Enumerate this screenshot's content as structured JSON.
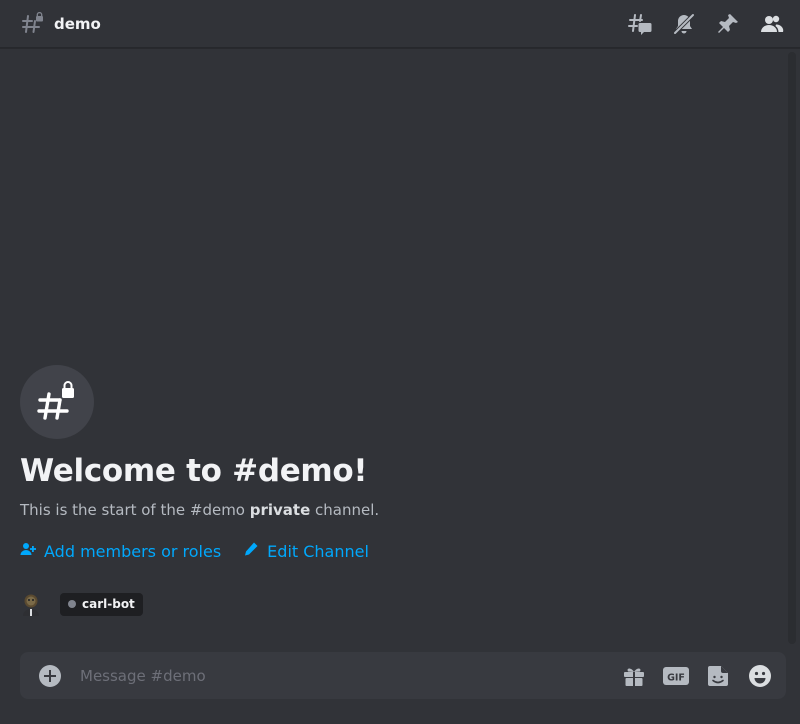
{
  "header": {
    "channel_name": "demo",
    "icons": [
      "locked-hash-icon",
      "threads-icon",
      "notifications-muted-icon",
      "pin-icon",
      "member-list-icon"
    ]
  },
  "welcome": {
    "title": "Welcome to #demo!",
    "subtitle_prefix": "This is the start of the #demo ",
    "subtitle_bold": "private",
    "subtitle_suffix": " channel.",
    "add_members_label": "Add members or roles",
    "edit_channel_label": "Edit Channel"
  },
  "members": [
    {
      "name": "carl-bot",
      "status_color": "#80848e"
    }
  ],
  "composer": {
    "placeholder": "Message #demo",
    "value": "",
    "gif_label": "GIF",
    "icons": [
      "add-attachment-icon",
      "gift-icon",
      "gif-icon",
      "sticker-icon",
      "emoji-icon"
    ]
  },
  "colors": {
    "background": "#313338",
    "composer": "#383a40",
    "link": "#00a8fc",
    "icon": "#b5bac1"
  }
}
